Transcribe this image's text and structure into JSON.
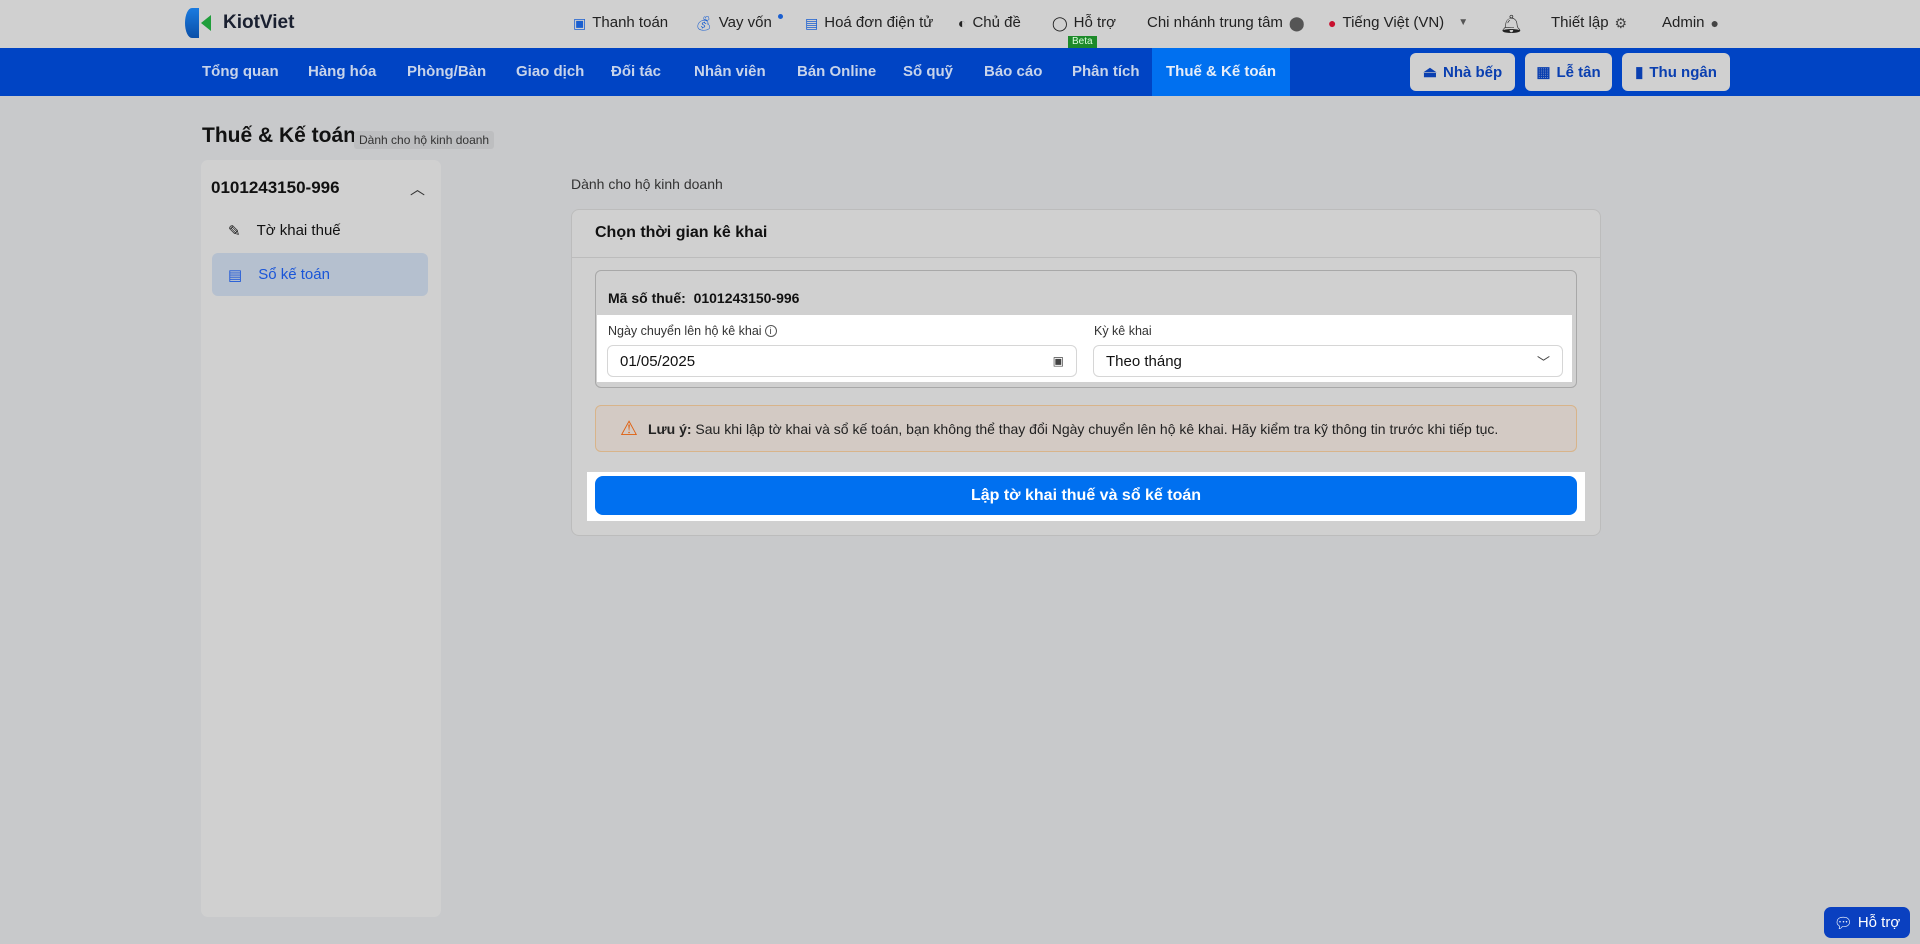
{
  "topbar": {
    "brand": "KiotViet",
    "items": [
      {
        "label": "Thanh toán",
        "icon": "wallet-icon"
      },
      {
        "label": "Vay vốn",
        "icon": "money-bag-icon"
      },
      {
        "label": "Hoá đơn điện tử",
        "icon": "invoice-icon"
      },
      {
        "label": "Chủ đề",
        "icon": "palette-icon"
      },
      {
        "label": "Hỗ trợ",
        "icon": "chat-icon",
        "badge": "Beta"
      },
      {
        "label": "Chi nhánh trung tâm",
        "icon": "location-pin-icon"
      },
      {
        "label": "Tiếng Việt (VN)",
        "icon": "vietnam-flag-icon"
      },
      {
        "label": "Thiết lập",
        "icon": "gear-icon"
      },
      {
        "label": "Admin",
        "icon": "user-circle-icon"
      }
    ]
  },
  "nav": {
    "tabs": [
      "Tổng quan",
      "Hàng hóa",
      "Phòng/Bàn",
      "Giao dịch",
      "Đối tác",
      "Nhân viên",
      "Bán Online",
      "Sổ quỹ",
      "Báo cáo",
      "Phân tích",
      "Thuế & Kế toán"
    ],
    "active": "Thuế & Kế toán",
    "quick_buttons": [
      "Nhà bếp",
      "Lễ tân",
      "Thu ngân"
    ]
  },
  "page": {
    "title": "Thuế & Kế toán",
    "badge": "Dành cho hộ kinh doanh",
    "subtitle": "Dành cho hộ kinh doanh"
  },
  "sidebar": {
    "header": "0101243150-996",
    "items": [
      {
        "label": "Tờ khai thuế",
        "active": false
      },
      {
        "label": "Sổ kế toán",
        "active": true
      }
    ]
  },
  "card": {
    "title": "Chọn thời gian kê khai",
    "tax_id_label": "Mã số thuế:",
    "tax_id": "0101243150-996",
    "date_label": "Ngày chuyển lên hộ kê khai",
    "date_value": "01/05/2025",
    "period_label": "Kỳ kê khai",
    "period_value": "Theo tháng",
    "warning_bold": "Lưu ý:",
    "warning_text": "Sau khi lập tờ khai và sổ kế toán, bạn không thể thay đổi Ngày chuyển lên hộ kê khai. Hãy kiểm tra kỹ thông tin trước khi tiếp tục.",
    "submit": "Lập tờ khai thuế và sổ kế toán"
  },
  "chat": {
    "label": "Hỗ trợ"
  },
  "colors": {
    "nav": "#0044c4",
    "accent": "#0070f0",
    "warning_border": "#d8b48a"
  }
}
